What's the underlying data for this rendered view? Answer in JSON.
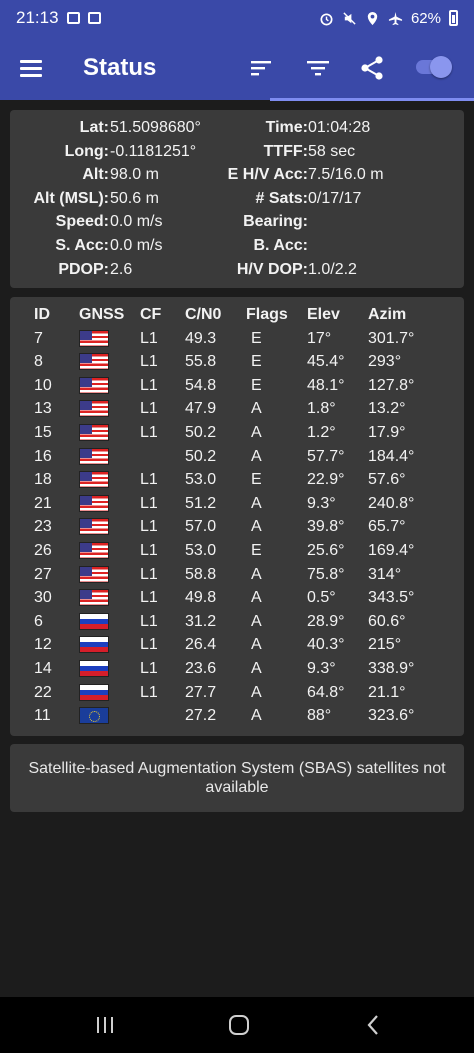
{
  "status_bar": {
    "time": "21:13",
    "battery": "62%"
  },
  "app_bar": {
    "title": "Status"
  },
  "location": {
    "rows": [
      {
        "l1": "Lat:",
        "v1": "51.5098680°",
        "l2": "Time:",
        "v2": "01:04:28"
      },
      {
        "l1": "Long:",
        "v1": "-0.1181251°",
        "l2": "TTFF:",
        "v2": "58 sec"
      },
      {
        "l1": "Alt:",
        "v1": "98.0 m",
        "l2": "E H/V Acc:",
        "v2": "7.5/16.0 m"
      },
      {
        "l1": "Alt (MSL):",
        "v1": "50.6 m",
        "l2": "# Sats:",
        "v2": "0/17/17"
      },
      {
        "l1": "Speed:",
        "v1": "0.0 m/s",
        "l2": "Bearing:",
        "v2": ""
      },
      {
        "l1": "S. Acc:",
        "v1": "0.0 m/s",
        "l2": "B. Acc:",
        "v2": ""
      },
      {
        "l1": "PDOP:",
        "v1": "2.6",
        "l2": "H/V DOP:",
        "v2": "1.0/2.2"
      }
    ]
  },
  "satellites": {
    "headers": {
      "id": "ID",
      "gnss": "GNSS",
      "cf": "CF",
      "cn0": "C/N0",
      "flags": "Flags",
      "elev": "Elev",
      "azim": "Azim"
    },
    "rows": [
      {
        "id": "7",
        "gnss": "us",
        "cf": "L1",
        "cn0": "49.3",
        "flags": "E",
        "elev": "17°",
        "azim": "301.7°"
      },
      {
        "id": "8",
        "gnss": "us",
        "cf": "L1",
        "cn0": "55.8",
        "flags": "E",
        "elev": "45.4°",
        "azim": "293°"
      },
      {
        "id": "10",
        "gnss": "us",
        "cf": "L1",
        "cn0": "54.8",
        "flags": "E",
        "elev": "48.1°",
        "azim": "127.8°"
      },
      {
        "id": "13",
        "gnss": "us",
        "cf": "L1",
        "cn0": "47.9",
        "flags": "A",
        "elev": "1.8°",
        "azim": "13.2°"
      },
      {
        "id": "15",
        "gnss": "us",
        "cf": "L1",
        "cn0": "50.2",
        "flags": "A",
        "elev": "1.2°",
        "azim": "17.9°"
      },
      {
        "id": "16",
        "gnss": "us",
        "cf": "",
        "cn0": "50.2",
        "flags": "A",
        "elev": "57.7°",
        "azim": "184.4°"
      },
      {
        "id": "18",
        "gnss": "us",
        "cf": "L1",
        "cn0": "53.0",
        "flags": "E",
        "elev": "22.9°",
        "azim": "57.6°"
      },
      {
        "id": "21",
        "gnss": "us",
        "cf": "L1",
        "cn0": "51.2",
        "flags": "A",
        "elev": "9.3°",
        "azim": "240.8°"
      },
      {
        "id": "23",
        "gnss": "us",
        "cf": "L1",
        "cn0": "57.0",
        "flags": "A",
        "elev": "39.8°",
        "azim": "65.7°"
      },
      {
        "id": "26",
        "gnss": "us",
        "cf": "L1",
        "cn0": "53.0",
        "flags": "E",
        "elev": "25.6°",
        "azim": "169.4°"
      },
      {
        "id": "27",
        "gnss": "us",
        "cf": "L1",
        "cn0": "58.8",
        "flags": "A",
        "elev": "75.8°",
        "azim": "314°"
      },
      {
        "id": "30",
        "gnss": "us",
        "cf": "L1",
        "cn0": "49.8",
        "flags": "A",
        "elev": "0.5°",
        "azim": "343.5°"
      },
      {
        "id": "6",
        "gnss": "ru",
        "cf": "L1",
        "cn0": "31.2",
        "flags": "A",
        "elev": "28.9°",
        "azim": "60.6°"
      },
      {
        "id": "12",
        "gnss": "ru",
        "cf": "L1",
        "cn0": "26.4",
        "flags": "A",
        "elev": "40.3°",
        "azim": "215°"
      },
      {
        "id": "14",
        "gnss": "ru",
        "cf": "L1",
        "cn0": "23.6",
        "flags": "A",
        "elev": "9.3°",
        "azim": "338.9°"
      },
      {
        "id": "22",
        "gnss": "ru",
        "cf": "L1",
        "cn0": "27.7",
        "flags": "A",
        "elev": "64.8°",
        "azim": "21.1°"
      },
      {
        "id": "11",
        "gnss": "eu",
        "cf": "",
        "cn0": "27.2",
        "flags": "A",
        "elev": "88°",
        "azim": "323.6°"
      }
    ]
  },
  "sbas": {
    "message": "Satellite-based Augmentation System (SBAS) satellites not available"
  },
  "icons": {
    "menu": "hamburger-menu-icon",
    "sort": "sort-icon",
    "filter": "filter-icon",
    "share": "share-icon",
    "toggle": "toggle-switch"
  },
  "colors": {
    "app_bar": "#3a49a8",
    "card": "#3a3a3a",
    "background": "#1c1c1c",
    "accent": "#7e8cf0"
  }
}
